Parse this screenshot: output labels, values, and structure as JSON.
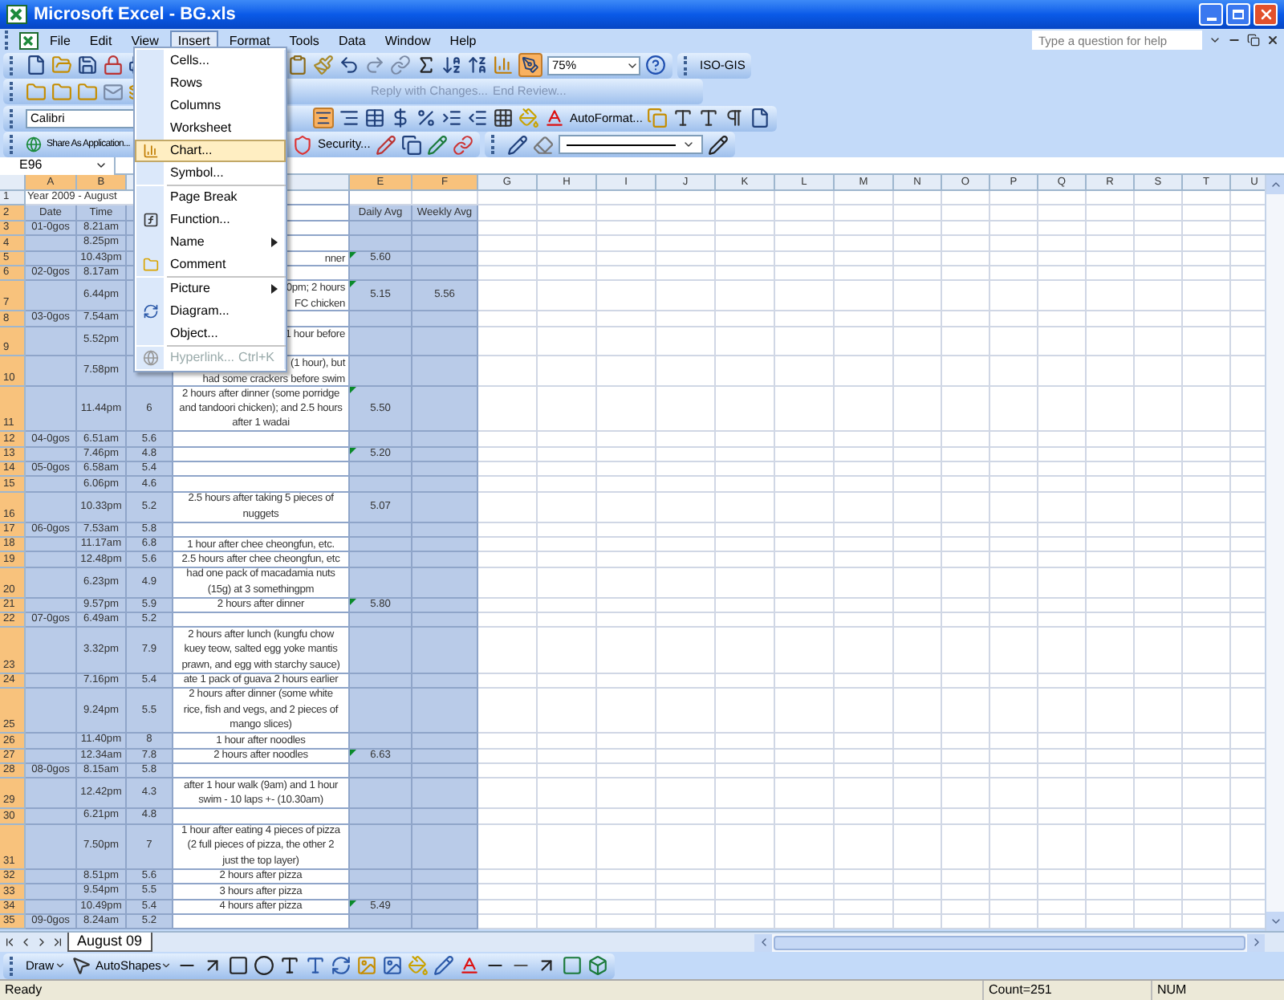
{
  "window": {
    "title": "Microsoft Excel - BG.xls"
  },
  "menu_bar": [
    {
      "label": "File",
      "selected": false
    },
    {
      "label": "Edit",
      "selected": false
    },
    {
      "label": "View",
      "selected": false
    },
    {
      "label": "Insert",
      "selected": true
    },
    {
      "label": "Format",
      "selected": false
    },
    {
      "label": "Tools",
      "selected": false
    },
    {
      "label": "Data",
      "selected": false
    },
    {
      "label": "Window",
      "selected": false
    },
    {
      "label": "Help",
      "selected": false
    }
  ],
  "help_box": {
    "placeholder": "Type a question for help"
  },
  "toolbars": {
    "zoom": "75%",
    "iso_toolbar": "ISO-GIS",
    "review": [
      "Reply with Changes...",
      "End Review..."
    ],
    "font": "Calibri",
    "autoformat": "AutoFormat...",
    "share": "Share As Application...",
    "security": "Security..."
  },
  "name_box": "E96",
  "column_headers": {
    "left": [
      {
        "label": "A",
        "selected": true
      },
      {
        "label": "B",
        "selected": true
      }
    ],
    "right": [
      {
        "label": "E",
        "selected": true
      },
      {
        "label": "F",
        "selected": true
      },
      {
        "label": "G",
        "selected": false
      },
      {
        "label": "H",
        "selected": false
      },
      {
        "label": "I",
        "selected": false
      },
      {
        "label": "J",
        "selected": false
      },
      {
        "label": "K",
        "selected": false
      },
      {
        "label": "L",
        "selected": false
      },
      {
        "label": "M",
        "selected": false
      },
      {
        "label": "N",
        "selected": false
      },
      {
        "label": "O",
        "selected": false
      },
      {
        "label": "P",
        "selected": false
      },
      {
        "label": "Q",
        "selected": false
      },
      {
        "label": "R",
        "selected": false
      },
      {
        "label": "S",
        "selected": false
      },
      {
        "label": "T",
        "selected": false
      },
      {
        "label": "U",
        "selected": false
      }
    ]
  },
  "rows": [
    {
      "number": "1",
      "selected": false,
      "flagged": false,
      "title": "Year 2009 - August"
    },
    {
      "number": "2",
      "selected": true,
      "flagged": false,
      "date": "Date",
      "time": "Time",
      "daily_avg": "Daily Avg",
      "weekly_avg": "Weekly Avg"
    },
    {
      "number": "3",
      "selected": true,
      "flagged": false,
      "date": "01-0gos",
      "time": "8.21am"
    },
    {
      "number": "4",
      "selected": true,
      "flagged": false,
      "time": "8.25pm"
    },
    {
      "number": "5",
      "selected": true,
      "flagged": true,
      "time": "10.43pm",
      "note": "nner",
      "daily_avg": "5.60"
    },
    {
      "number": "6",
      "selected": true,
      "flagged": false,
      "date": "02-0gos",
      "time": "8.17am"
    },
    {
      "number": "7",
      "selected": true,
      "flagged": true,
      "time": "6.44pm",
      "note": "0pm; 2 hours\nFC chicken",
      "daily_avg": "5.15",
      "weekly_avg": "5.56"
    },
    {
      "number": "8",
      "selected": true,
      "flagged": false,
      "date": "03-0gos",
      "time": "7.54am"
    },
    {
      "number": "9",
      "selected": true,
      "flagged": false,
      "time": "5.52pm",
      "note": "1 hour before"
    },
    {
      "number": "10",
      "selected": true,
      "flagged": false,
      "time": "7.58pm",
      "note": "(1 hour), but\nhad some crackers before swim"
    },
    {
      "number": "11",
      "selected": true,
      "flagged": true,
      "time": "11.44pm",
      "reading": "6",
      "note": "2 hours after dinner (some porridge\nand tandoori chicken); and 2.5 hours\nafter 1 wadai",
      "daily_avg": "5.50"
    },
    {
      "number": "12",
      "selected": true,
      "flagged": false,
      "date": "04-0gos",
      "time": "6.51am",
      "reading": "5.6"
    },
    {
      "number": "13",
      "selected": true,
      "flagged": true,
      "time": "7.46pm",
      "reading": "4.8",
      "daily_avg": "5.20"
    },
    {
      "number": "14",
      "selected": true,
      "flagged": false,
      "date": "05-0gos",
      "time": "6.58am",
      "reading": "5.4"
    },
    {
      "number": "15",
      "selected": true,
      "flagged": false,
      "time": "6.06pm",
      "reading": "4.6"
    },
    {
      "number": "16",
      "selected": true,
      "flagged": false,
      "time": "10.33pm",
      "reading": "5.2",
      "note": "2.5 hours after taking 5 pieces of\nnuggets",
      "daily_avg": "5.07"
    },
    {
      "number": "17",
      "selected": true,
      "flagged": false,
      "date": "06-0gos",
      "time": "7.53am",
      "reading": "5.8"
    },
    {
      "number": "18",
      "selected": true,
      "flagged": false,
      "time": "11.17am",
      "reading": "6.8",
      "note": "1 hour after chee cheongfun, etc."
    },
    {
      "number": "19",
      "selected": true,
      "flagged": false,
      "time": "12.48pm",
      "reading": "5.6",
      "note": "2.5 hours after chee cheongfun, etc"
    },
    {
      "number": "20",
      "selected": true,
      "flagged": false,
      "time": "6.23pm",
      "reading": "4.9",
      "note": "had one pack of macadamia nuts\n(15g) at 3 somethingpm"
    },
    {
      "number": "21",
      "selected": true,
      "flagged": true,
      "time": "9.57pm",
      "reading": "5.9",
      "note": "2 hours after dinner",
      "daily_avg": "5.80"
    },
    {
      "number": "22",
      "selected": true,
      "flagged": false,
      "date": "07-0gos",
      "time": "6.49am",
      "reading": "5.2"
    },
    {
      "number": "23",
      "selected": true,
      "flagged": false,
      "time": "3.32pm",
      "reading": "7.9",
      "note": "2 hours after lunch (kungfu chow\nkuey teow, salted egg yoke mantis\nprawn, and egg with starchy sauce)"
    },
    {
      "number": "24",
      "selected": true,
      "flagged": false,
      "time": "7.16pm",
      "reading": "5.4",
      "note": "ate 1 pack of guava 2 hours earlier"
    },
    {
      "number": "25",
      "selected": true,
      "flagged": false,
      "time": "9.24pm",
      "reading": "5.5",
      "note": "2 hours after dinner (some white\nrice, fish and vegs, and 2 pieces of\nmango slices)"
    },
    {
      "number": "26",
      "selected": true,
      "flagged": false,
      "time": "11.40pm",
      "reading": "8",
      "note": "1 hour after noodles"
    },
    {
      "number": "27",
      "selected": true,
      "flagged": true,
      "time": "12.34am",
      "reading": "7.8",
      "note": "2 hours after noodles",
      "daily_avg": "6.63"
    },
    {
      "number": "28",
      "selected": true,
      "flagged": false,
      "date": "08-0gos",
      "time": "8.15am",
      "reading": "5.8"
    },
    {
      "number": "29",
      "selected": true,
      "flagged": false,
      "time": "12.42pm",
      "reading": "4.3",
      "note": "after 1 hour walk (9am) and 1 hour\nswim - 10 laps +- (10.30am)"
    },
    {
      "number": "30",
      "selected": true,
      "flagged": false,
      "time": "6.21pm",
      "reading": "4.8"
    },
    {
      "number": "31",
      "selected": true,
      "flagged": false,
      "time": "7.50pm",
      "reading": "7",
      "note": "1 hour after eating 4 pieces of pizza\n(2 full pieces of pizza, the other 2\njust the top layer)"
    },
    {
      "number": "32",
      "selected": true,
      "flagged": false,
      "time": "8.51pm",
      "reading": "5.6",
      "note": "2 hours after pizza"
    },
    {
      "number": "33",
      "selected": true,
      "flagged": false,
      "time": "9.54pm",
      "reading": "5.5",
      "note": "3 hours after pizza"
    },
    {
      "number": "34",
      "selected": true,
      "flagged": true,
      "time": "10.49pm",
      "reading": "5.4",
      "note": "4 hours after pizza",
      "daily_avg": "5.49"
    },
    {
      "number": "35",
      "selected": true,
      "flagged": false,
      "date": "09-0gos",
      "time": "8.24am",
      "reading": "5.2"
    }
  ],
  "insert_menu": [
    {
      "label": "Cells...",
      "kind": "command",
      "selected": false,
      "disabled": false,
      "separator_after": false
    },
    {
      "label": "Rows",
      "kind": "command",
      "selected": false,
      "disabled": false,
      "separator_after": false
    },
    {
      "label": "Columns",
      "kind": "command",
      "selected": false,
      "disabled": false,
      "separator_after": false
    },
    {
      "label": "Worksheet",
      "kind": "command",
      "selected": false,
      "disabled": false,
      "separator_after": false
    },
    {
      "label": "Chart...",
      "kind": "command",
      "selected": true,
      "disabled": false,
      "separator_after": false
    },
    {
      "label": "Symbol...",
      "kind": "command",
      "selected": false,
      "disabled": false,
      "separator_after": true
    },
    {
      "label": "Page Break",
      "kind": "command",
      "selected": false,
      "disabled": false,
      "separator_after": false
    },
    {
      "label": "Function...",
      "kind": "command",
      "selected": false,
      "disabled": false,
      "separator_after": false
    },
    {
      "label": "Name",
      "kind": "submenu",
      "selected": false,
      "disabled": false,
      "separator_after": false
    },
    {
      "label": "Comment",
      "kind": "command",
      "selected": false,
      "disabled": false,
      "separator_after": true
    },
    {
      "label": "Picture",
      "kind": "submenu",
      "selected": false,
      "disabled": false,
      "separator_after": false
    },
    {
      "label": "Diagram...",
      "kind": "command",
      "selected": false,
      "disabled": false,
      "separator_after": false
    },
    {
      "label": "Object...",
      "kind": "command",
      "selected": false,
      "disabled": false,
      "separator_after": true
    },
    {
      "label": "Hyperlink...",
      "kind": "command",
      "selected": false,
      "disabled": true,
      "separator_after": false,
      "shortcut": "Ctrl+K"
    }
  ],
  "sheet_tabs": [
    {
      "label": "August 09",
      "selected": true
    }
  ],
  "drawing_toolbar": {
    "draw": "Draw",
    "autoshapes": "AutoShapes"
  },
  "status_bar": {
    "status": "Ready",
    "count": "Count=251",
    "num": "NUM"
  }
}
